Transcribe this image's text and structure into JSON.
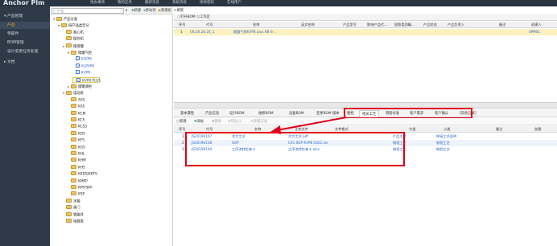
{
  "app": {
    "brand": "Anchor Plm",
    "top_menu": [
      "待办事项",
      "我的任务",
      "最新消息",
      "系统消息",
      "修改密码",
      "在线用户"
    ]
  },
  "sidebar": {
    "items": [
      {
        "label": "产品管理",
        "level": 0,
        "active": false
      },
      {
        "label": "产品",
        "level": 1,
        "active": true
      },
      {
        "label": "零部件",
        "level": 1,
        "active": false
      },
      {
        "label": "BOM管理",
        "level": 1,
        "active": false
      },
      {
        "label": "设计变更任务处理",
        "level": 1,
        "active": false
      },
      {
        "label": "文档",
        "level": 0,
        "active": false
      }
    ]
  },
  "tree_toolbar": {
    "search_placeholder": "产品",
    "buttons": [
      "新建",
      "移动到",
      "新建组",
      "刷新"
    ]
  },
  "tree": {
    "nodes": [
      {
        "label": "产品分类",
        "indent": 0,
        "kind": "folder",
        "arrow": "▾"
      },
      {
        "label": "研产品类型分",
        "indent": 1,
        "kind": "folder",
        "arrow": "▾"
      },
      {
        "label": "离心机",
        "indent": 2,
        "kind": "folder",
        "arrow": ""
      },
      {
        "label": "搅拌机",
        "indent": 2,
        "kind": "folder",
        "arrow": ""
      },
      {
        "label": "储液罐",
        "indent": 2,
        "kind": "folder",
        "arrow": "▾"
      },
      {
        "label": "储罐气柜",
        "indent": 3,
        "kind": "folder",
        "arrow": "▾"
      },
      {
        "label": "KLVP6",
        "indent": 4,
        "kind": "leaf",
        "arrow": ""
      },
      {
        "label": "KLPVP6",
        "indent": 4,
        "kind": "leaf",
        "arrow": ""
      },
      {
        "label": "KVP8",
        "indent": 4,
        "kind": "leaf",
        "arrow": ""
      },
      {
        "label": "KVP8 PLUS",
        "indent": 4,
        "kind": "leaf",
        "arrow": "",
        "selected": true
      },
      {
        "label": "储罐液柜",
        "indent": 3,
        "kind": "folder",
        "arrow": "▸"
      },
      {
        "label": "电动泵",
        "indent": 2,
        "kind": "folder",
        "arrow": "▾"
      },
      {
        "label": "AS5",
        "indent": 3,
        "kind": "folder",
        "arrow": ""
      },
      {
        "label": "KA5",
        "indent": 3,
        "kind": "folder",
        "arrow": ""
      },
      {
        "label": "KCM",
        "indent": 3,
        "kind": "folder",
        "arrow": ""
      },
      {
        "label": "KCS",
        "indent": 3,
        "kind": "folder",
        "arrow": ""
      },
      {
        "label": "KCS3",
        "indent": 3,
        "kind": "folder",
        "arrow": ""
      },
      {
        "label": "KDS",
        "indent": 3,
        "kind": "folder",
        "arrow": ""
      },
      {
        "label": "KFS",
        "indent": 3,
        "kind": "folder",
        "arrow": ""
      },
      {
        "label": "KGS",
        "indent": 3,
        "kind": "folder",
        "arrow": ""
      },
      {
        "label": "KHL",
        "indent": 3,
        "kind": "folder",
        "arrow": ""
      },
      {
        "label": "KHM",
        "indent": 3,
        "kind": "folder",
        "arrow": ""
      },
      {
        "label": "KHS",
        "indent": 3,
        "kind": "folder",
        "arrow": ""
      },
      {
        "label": "KKDS/KKTS",
        "indent": 3,
        "kind": "folder",
        "arrow": ""
      },
      {
        "label": "KMPP",
        "indent": 3,
        "kind": "folder",
        "arrow": ""
      },
      {
        "label": "KPP/SKP",
        "indent": 3,
        "kind": "folder",
        "arrow": ""
      },
      {
        "label": "KSP",
        "indent": 3,
        "kind": "folder",
        "arrow": ""
      },
      {
        "label": "水箱",
        "indent": 2,
        "kind": "folder",
        "arrow": ""
      },
      {
        "label": "阀门",
        "indent": 2,
        "kind": "folder",
        "arrow": ""
      },
      {
        "label": "管路件",
        "indent": 2,
        "kind": "folder",
        "arrow": ""
      },
      {
        "label": "电器类",
        "indent": 2,
        "kind": "folder",
        "arrow": ""
      }
    ]
  },
  "product_grid": {
    "toolbar": [
      "打开BOM",
      "工作区"
    ],
    "columns": [
      "序号",
      "代号",
      "名称",
      "英文名称",
      "产品型号",
      "影响产品代...",
      "投影类别编...",
      "产品状态",
      "产品负责人",
      "备注",
      "创建人"
    ],
    "rows": [
      {
        "index": "1",
        "code": "CK.20.20.24_1",
        "name": "随量气泵KVP8 plus KB-S-...",
        "creator": "SPM01"
      }
    ]
  },
  "tabs": {
    "items": [
      "基本属性",
      "产品信息",
      "设计BOM",
      "维修BOM",
      "设备BOM",
      "变更BOM",
      "版本",
      "图档",
      "相关工艺",
      "销售标准",
      "客户需求",
      "客户确认",
      "[其他方式]"
    ],
    "active": "相关工艺"
  },
  "doc_toolbar": {
    "buttons": [
      {
        "label": "新建",
        "enabled": true
      },
      {
        "label": "添加",
        "enabled": true
      },
      {
        "label": "删除",
        "enabled": false
      },
      {
        "label": "检出/入",
        "enabled": false
      },
      {
        "label": "查看记录",
        "enabled": false
      }
    ]
  },
  "doc_grid": {
    "columns": [
      "序号",
      "代号",
      "名称",
      "主体文件",
      "文件格式",
      "大类",
      "小类",
      "备注",
      "创建"
    ],
    "rows": [
      {
        "index": "1",
        "code": "JS20190107",
        "name": "涂大工艺",
        "file": "涂大工艺.pdf",
        "major": "产品文件",
        "minor": "焊接工艺说明"
      },
      {
        "index": "2",
        "code": "JS20190138",
        "name": "SOP",
        "file": "C01 SOP KVP8 0322.xls",
        "major": "制程工艺",
        "minor": "制程工艺"
      },
      {
        "index": "3",
        "code": "JS20190140",
        "name": "工序流转检查卡",
        "file": "工序流转检查卡.xlsx",
        "major": "制程工艺",
        "minor": "制程工艺"
      }
    ]
  },
  "colors": {
    "header_bg": "#2a3543",
    "sidebar_bg": "#2e3a48",
    "active_accent": "#f5a623",
    "link_blue": "#2b64c8",
    "selected_row": "#fdf1c0",
    "annotation_red": "#e0001a"
  }
}
